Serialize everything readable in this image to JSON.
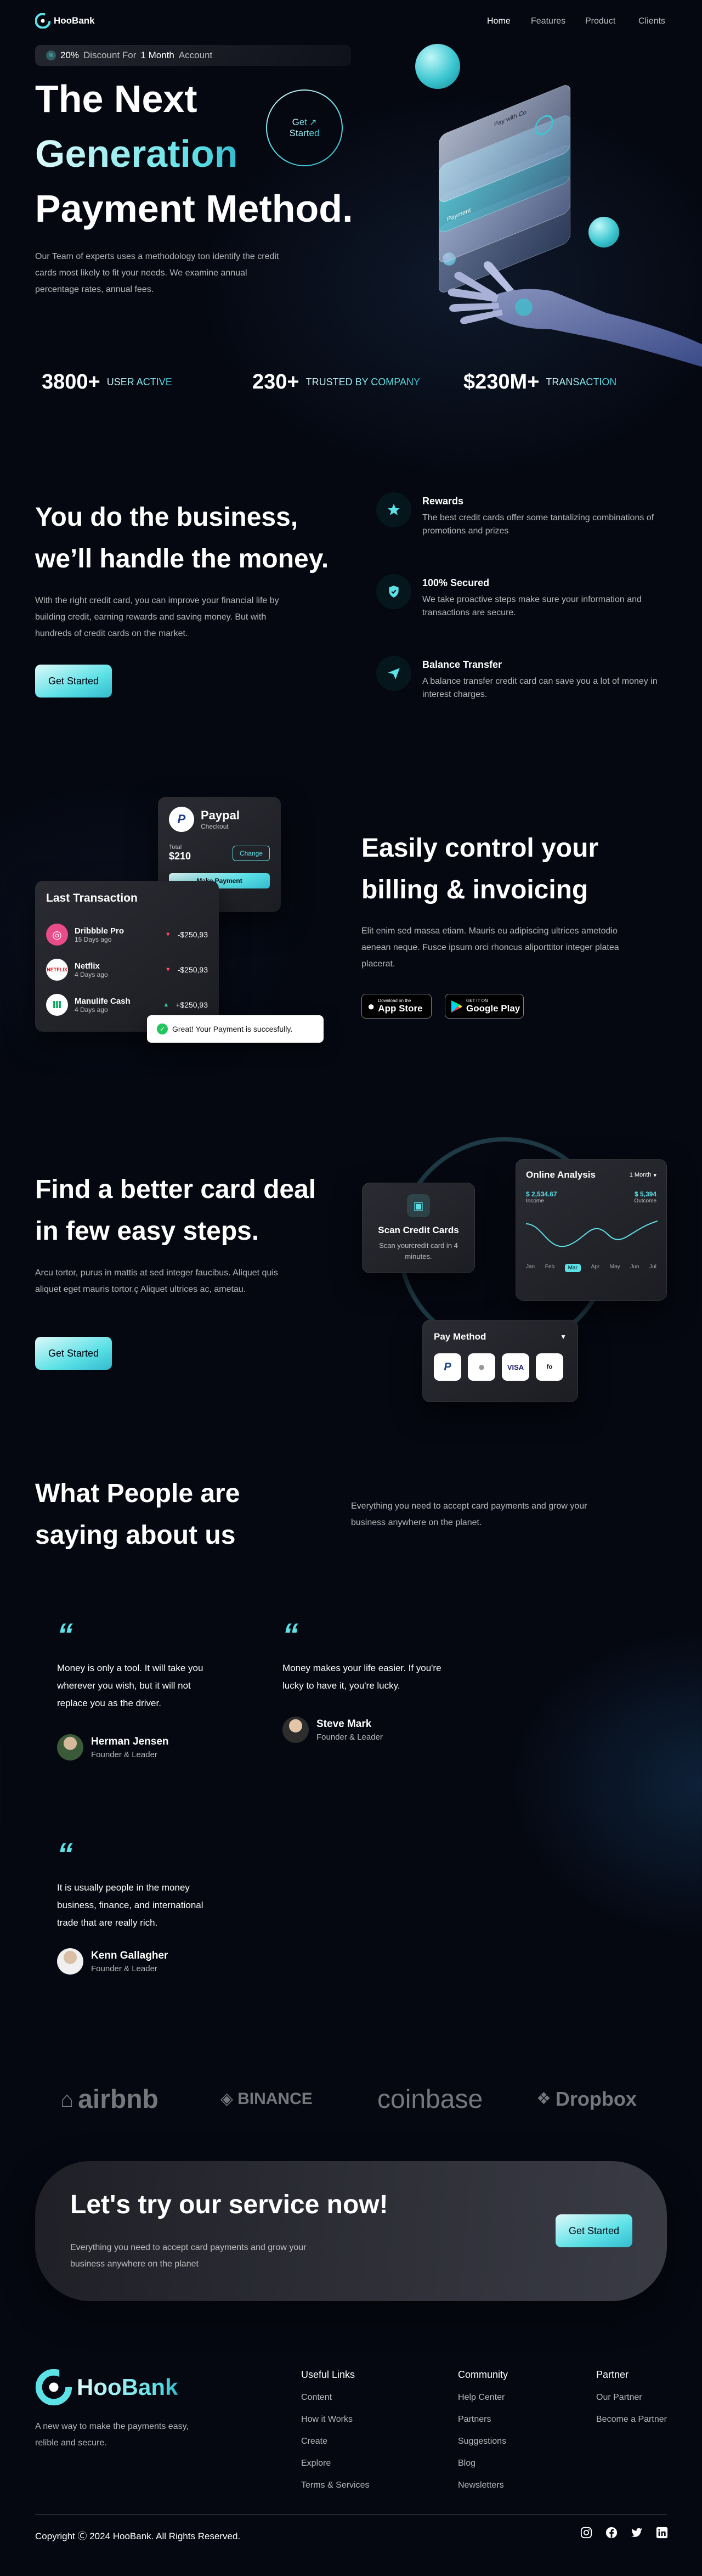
{
  "nav": {
    "logo_text": "HooBank",
    "links": [
      "Home",
      "Features",
      "Product",
      "Clients"
    ]
  },
  "hero": {
    "badge_pct": "20%",
    "badge_mid": "Discount For",
    "badge_one": "1 Month",
    "badge_tail": "Account",
    "title_1": "The Next",
    "title_2": "Generation",
    "title_3": "Payment Method.",
    "description": "Our Team of experts uses a methodology ton identify the credit cards most likely to fit your needs. We examine annual percentage rates, annual fees.",
    "cta_line1": "Get",
    "cta_line2": "Started",
    "card_top_text": "Pay with Co",
    "card_bottom_text": "Payment"
  },
  "stats": [
    {
      "value": "3800+",
      "label": "USER ACTIVE"
    },
    {
      "value": "230+",
      "label": "TRUSTED BY COMPANY"
    },
    {
      "value": "$230M+",
      "label": "TRANSACTION"
    }
  ],
  "business": {
    "title_1": "You do the business,",
    "title_2": "we’ll handle the money.",
    "description": "With the right credit card, you can improve your financial life by building credit, earning rewards and saving money. But with hundreds of credit cards on the market.",
    "button": "Get Started",
    "features": [
      {
        "title": "Rewards",
        "text": "The best credit cards offer some tantalizing combinations of promotions and prizes",
        "icon": "star-icon"
      },
      {
        "title": "100% Secured",
        "text": "We take proactive steps make sure your information and transactions are secure.",
        "icon": "shield-icon"
      },
      {
        "title": "Balance Transfer",
        "text": "A balance transfer credit card can save you a lot of money in interest charges.",
        "icon": "send-icon"
      }
    ]
  },
  "billing": {
    "title_1": "Easily control your",
    "title_2": "billing & invoicing",
    "description": "Elit enim sed massa etiam. Mauris eu adipiscing ultrices ametodio aenean neque. Fusce ipsum orci rhoncus aliporttitor integer platea placerat.",
    "appstore_small": "Download on the",
    "appstore_big": "App Store",
    "googleplay_small": "GET IT ON",
    "googleplay_big": "Google Play",
    "paypal_card": {
      "title": "Paypal",
      "subtitle": "Checkout",
      "total_label": "Total",
      "total_value": "$210",
      "change_label": "Change",
      "make_payment": "Make Payment"
    },
    "transactions": {
      "title": "Last Transaction",
      "items": [
        {
          "name": "Dribbble Pro",
          "time": "15 Days ago",
          "amount": "-$250,93",
          "dir": "down"
        },
        {
          "name": "Netflix",
          "time": "4 Days ago",
          "amount": "-$250,93",
          "dir": "down"
        },
        {
          "name": "Manulife Cash",
          "time": "4 Days ago",
          "amount": "+$250,93",
          "dir": "up"
        }
      ]
    },
    "toast": "Great! Your Payment is succesfully."
  },
  "deal": {
    "title_1": "Find a better card deal",
    "title_2": "in few easy steps.",
    "description": "Arcu tortor, purus in mattis at sed integer faucibus. Aliquet quis aliquet eget mauris tortor.ç Aliquet ultrices ac, ametau.",
    "button": "Get Started",
    "scan_card": {
      "title": "Scan Credit Cards",
      "text": "Scan yourcredit card in 4 minutes."
    },
    "analysis": {
      "title": "Online Analysis",
      "period": "1 Month",
      "income_value": "$ 2,534.67",
      "income_label": "Income",
      "outcome_value": "$ 5,394",
      "outcome_label": "Outcome",
      "months": [
        "Jan",
        "Feb",
        "Mar",
        "Apr",
        "May",
        "Jun",
        "Jul"
      ],
      "active_month": "Mar"
    },
    "pay_method": {
      "title": "Pay Method",
      "methods": [
        "P",
        "",
        "VISA",
        "fo"
      ]
    }
  },
  "testimonials": {
    "title_1": "What People are",
    "title_2": "saying about us",
    "description": "Everything you need to accept card payments and grow your business anywhere on the planet.",
    "items": [
      {
        "quote": "Money is only a tool. It will take you wherever you wish, but it will not replace you as the driver.",
        "name": "Herman Jensen",
        "role": "Founder & Leader"
      },
      {
        "quote": "Money makes your life easier. If you're lucky to have it, you're lucky.",
        "name": "Steve Mark",
        "role": "Founder & Leader"
      },
      {
        "quote": "It is usually people in the money business, finance, and international trade that are really rich.",
        "name": "Kenn Gallagher",
        "role": "Founder & Leader"
      }
    ]
  },
  "clients": [
    "airbnb",
    "BINANCE",
    "coinbase",
    "Dropbox"
  ],
  "cta": {
    "title": "Let's try our service now!",
    "description": "Everything you need to accept card payments and grow your business anywhere on the planet",
    "button": "Get Started"
  },
  "footer": {
    "logo_text": "HooBank",
    "tagline": "A new way to make the payments easy, relible and secure.",
    "columns": [
      {
        "title": "Useful Links",
        "links": [
          "Content",
          "How it Works",
          "Create",
          "Explore",
          "Terms & Services"
        ]
      },
      {
        "title": "Community",
        "links": [
          "Help Center",
          "Partners",
          "Suggestions",
          "Blog",
          "Newsletters"
        ]
      },
      {
        "title": "Partner",
        "links": [
          "Our Partner",
          "Become a Partner"
        ]
      }
    ],
    "copyright": "Copyright Ⓒ 2024 HooBank. All Rights Reserved."
  },
  "colors": {
    "accent": "#5ce1e6",
    "background": "#050811",
    "card": "#2b2c33"
  }
}
